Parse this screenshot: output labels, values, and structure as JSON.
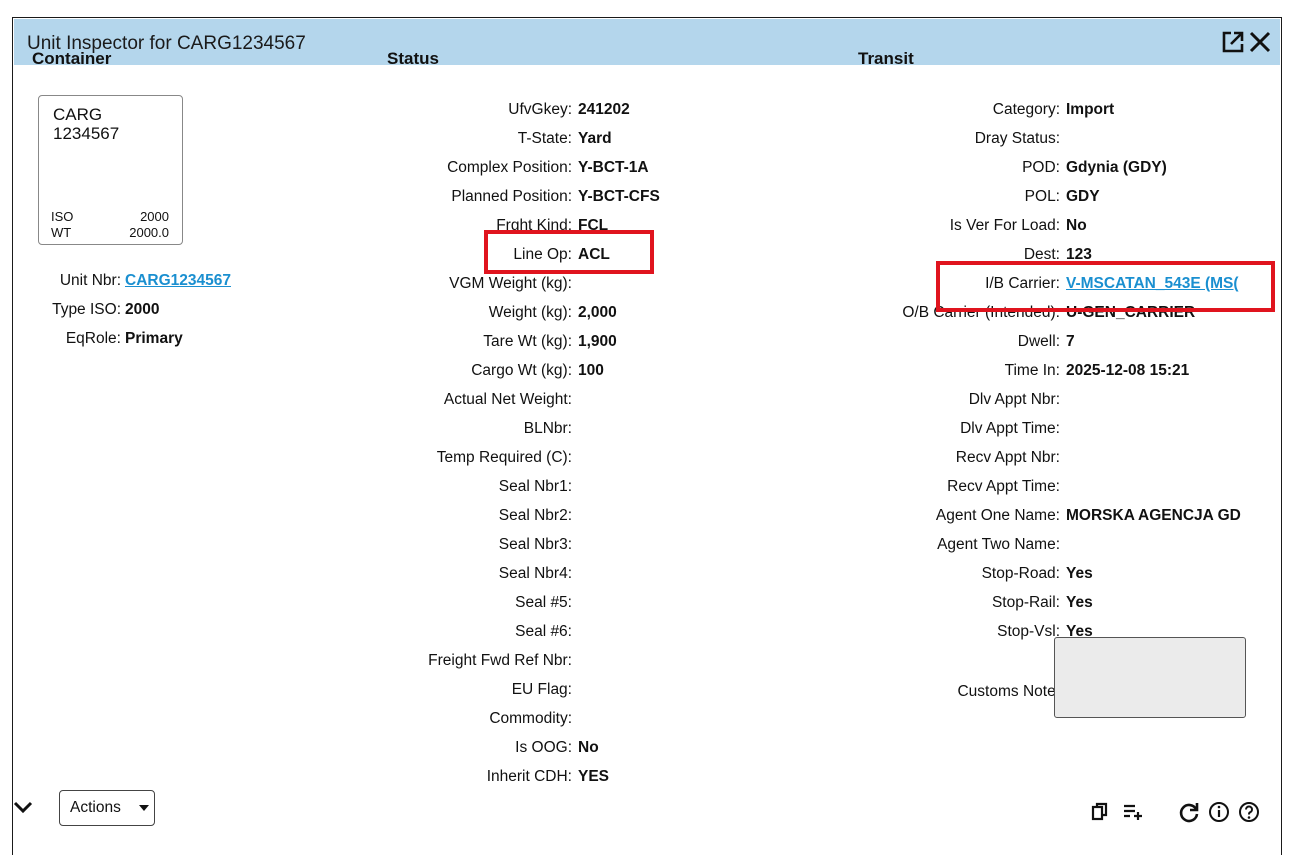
{
  "window": {
    "title": "Unit Inspector for CARG1234567",
    "icons": [
      "popout-icon",
      "close-icon"
    ]
  },
  "sections": {
    "container": "Container",
    "status": "Status",
    "transit": "Transit"
  },
  "card": {
    "id_line1": "CARG",
    "id_line2": "1234567",
    "iso_label": "ISO",
    "iso_value": "2000",
    "wt_label": "WT",
    "wt_value": "2000.0"
  },
  "container_fields": [
    {
      "label": "Unit Nbr:",
      "value": "CARG1234567"
    },
    {
      "label": "Type ISO:",
      "value": "2000"
    },
    {
      "label": "EqRole:",
      "value": "Primary"
    }
  ],
  "status_fields": [
    {
      "label": "UfvGkey:",
      "value": "241202"
    },
    {
      "label": "T-State:",
      "value": "Yard"
    },
    {
      "label": "Complex Position:",
      "value": "Y-BCT-1A"
    },
    {
      "label": "Planned Position:",
      "value": "Y-BCT-CFS"
    },
    {
      "label": "Frght Kind:",
      "value": "FCL"
    },
    {
      "label": "Line Op:",
      "value": "ACL"
    },
    {
      "label": "VGM Weight (kg):",
      "value": ""
    },
    {
      "label": "Weight (kg):",
      "value": "2,000"
    },
    {
      "label": "Tare Wt (kg):",
      "value": "1,900"
    },
    {
      "label": "Cargo Wt (kg):",
      "value": "100"
    },
    {
      "label": "Actual Net Weight:",
      "value": ""
    },
    {
      "label": "BLNbr:",
      "value": ""
    },
    {
      "label": "Temp Required (C):",
      "value": ""
    },
    {
      "label": "Seal Nbr1:",
      "value": ""
    },
    {
      "label": "Seal Nbr2:",
      "value": ""
    },
    {
      "label": "Seal Nbr3:",
      "value": ""
    },
    {
      "label": "Seal Nbr4:",
      "value": ""
    },
    {
      "label": "Seal #5:",
      "value": ""
    },
    {
      "label": "Seal #6:",
      "value": ""
    },
    {
      "label": "Freight Fwd Ref Nbr:",
      "value": ""
    },
    {
      "label": "EU Flag:",
      "value": ""
    },
    {
      "label": "Commodity:",
      "value": ""
    },
    {
      "label": "Is OOG:",
      "value": "No"
    },
    {
      "label": "Inherit CDH:",
      "value": "YES"
    }
  ],
  "transit_fields": [
    {
      "label": "Category:",
      "value": "Import"
    },
    {
      "label": "Dray Status:",
      "value": ""
    },
    {
      "label": "POD:",
      "value": "Gdynia (GDY)"
    },
    {
      "label": "POL:",
      "value": "GDY"
    },
    {
      "label": "Is Ver For Load:",
      "value": "No"
    },
    {
      "label": "Dest:",
      "value": "123"
    },
    {
      "label": "I/B Carrier:",
      "value": "V-MSCATAN_543E (MS("
    },
    {
      "label": "O/B Carrier (Intended):",
      "value": "U-GEN_CARRIER"
    },
    {
      "label": "Dwell:",
      "value": "7"
    },
    {
      "label": "Time In:",
      "value": "2025-12-08 15:21"
    },
    {
      "label": "Dlv Appt Nbr:",
      "value": ""
    },
    {
      "label": "Dlv Appt Time:",
      "value": ""
    },
    {
      "label": "Recv Appt Nbr:",
      "value": ""
    },
    {
      "label": "Recv Appt Time:",
      "value": ""
    },
    {
      "label": "Agent One Name:",
      "value": "MORSKA AGENCJA GD"
    },
    {
      "label": "Agent Two Name:",
      "value": ""
    },
    {
      "label": "Stop-Road:",
      "value": "Yes"
    },
    {
      "label": "Stop-Rail:",
      "value": "Yes"
    },
    {
      "label": "Stop-Vsl:",
      "value": "Yes"
    },
    {
      "label": "Customs Note:",
      "value": ""
    }
  ],
  "footer": {
    "actions_label": "Actions",
    "icons": [
      "expand-chevron-icon",
      "copy-icon",
      "add-to-list-icon",
      "refresh-icon",
      "info-icon",
      "help-icon"
    ]
  },
  "highlight_color": "#e0141e",
  "link_color": "#1a8fd0"
}
